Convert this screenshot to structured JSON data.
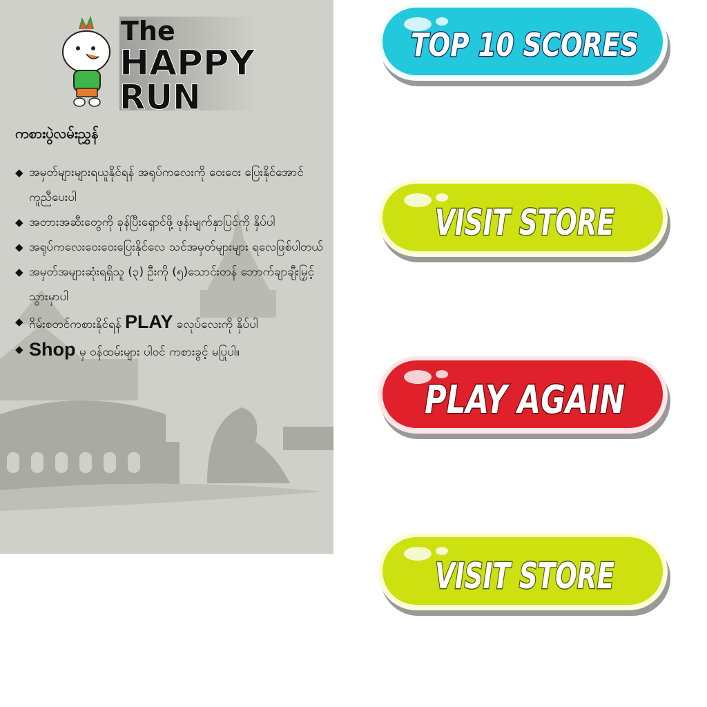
{
  "logo": {
    "line1": "The",
    "line2": "HAPPY",
    "line3": "RUN"
  },
  "rules": {
    "title": "ကစားပွဲလမ်းညွှန်",
    "items": [
      {
        "text": "အမှတ်များများရယူနိုင်ရန် အရုပ်ကလေးကို ဝေးဝေး ပြေးနိုင်အောင်ကူညီပေးပါ"
      },
      {
        "text": "အတားအဆီးတွေကို ခုန်ပြီးရှောင်ဖို့ ဖုန်းမျက်နှာပြင်ကို နှိပ်ပါ"
      },
      {
        "text": "အရုပ်ကလေးဝေးဝေးပြေးနိုင်လေ သင်အမှတ်များများ ရလေဖြစ်ပါတယ်"
      },
      {
        "text": "အမှတ်အများဆုံးရရှိသူ (၃) ဦးကို (၅)သောင်းတန် ဘောက်ချာချီးမြှင့်သွားမှာပါ"
      },
      {
        "pre": "ဂိမ်းစတင်ကစားနိုင်ရန် ",
        "bold": "PLAY",
        "post": " ခလုပ်လေးကို နှိပ်ပါ"
      },
      {
        "pre": "",
        "bold": "Shop",
        "post": " မှ ဝန်ထမ်းများ ပါဝင် ကစားခွင့် မပြုပါ။"
      }
    ]
  },
  "buttons": {
    "top_scores": {
      "label": "TOP 10 SCORES",
      "color": "#22c8dc"
    },
    "visit_store_1": {
      "label": "VISIT STORE",
      "color": "#cde010"
    },
    "play_again": {
      "label": "PLAY AGAIN",
      "color": "#e0202a"
    },
    "visit_store_2": {
      "label": "VISIT STORE",
      "color": "#cde010"
    }
  }
}
